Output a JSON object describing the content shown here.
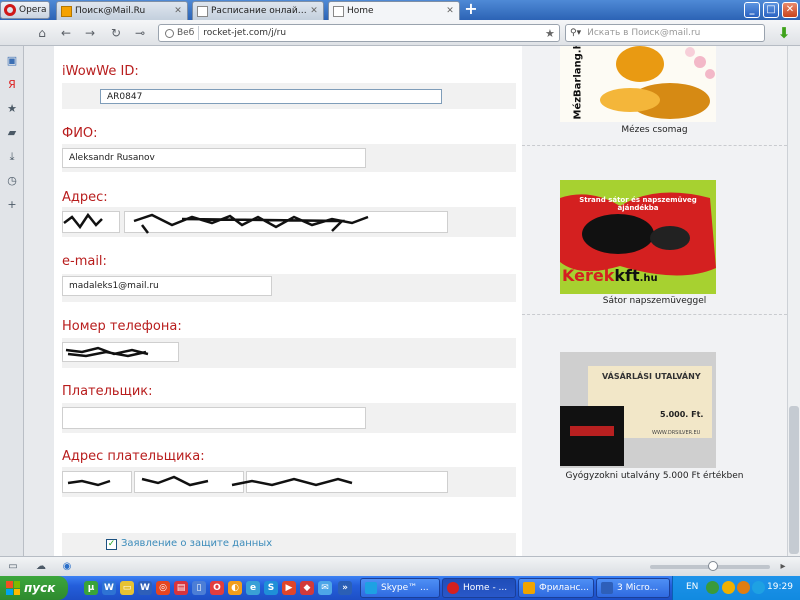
{
  "browser": {
    "menu_label": "Opera",
    "tabs": [
      {
        "label": "Поиск@Mail.Ru"
      },
      {
        "label": "Расписание онлайн пре..."
      },
      {
        "label": "Home"
      }
    ],
    "address": {
      "badge": "Веб",
      "url": "rocket-jet.com/j/ru"
    },
    "search_placeholder": "Искать в Поиск@mail.ru"
  },
  "form": {
    "fields": [
      {
        "label": "iWowWe ID:",
        "value": "AR0847"
      },
      {
        "label": "ФИО:",
        "value": "Aleksandr Rusanov"
      },
      {
        "label": "Адрес:",
        "value": ""
      },
      {
        "label": "e-mail:",
        "value": "madaleks1@mail.ru"
      },
      {
        "label": "Номер телефона:",
        "value": ""
      },
      {
        "label": "Плательщик:",
        "value": ""
      },
      {
        "label": "Адрес плательщика:",
        "value": ""
      }
    ],
    "consent": {
      "label": "Заявление о защите данных",
      "checked": true
    }
  },
  "ads": [
    {
      "caption": "Mézes csomag",
      "image_text": "MézBarlang.hu"
    },
    {
      "caption": "Sátor napszemüveggel",
      "image_text_top": "Strand sátor és napszemüveg ajándékba",
      "image_brand": "Kerék",
      "image_brand2": "kft",
      "image_brand3": ".hu"
    },
    {
      "caption": "Gyógyzokni utalvány 5.000 Ft értékben",
      "image_title": "VÁSÁRLÁSI UTALVÁNY",
      "image_amount": "5.000. Ft.",
      "image_url": "WWW.DRSILVER.EU"
    }
  ],
  "taskbar": {
    "start_label": "пуск",
    "tasks": [
      {
        "label": "Skype™ ..."
      },
      {
        "label": "Home - ..."
      },
      {
        "label": "Фриланс..."
      },
      {
        "label": "3 Micro..."
      }
    ],
    "lang": "EN",
    "clock": "19:29"
  },
  "colors": {
    "label_red": "#b81d1d",
    "link_blue": "#3b8bba",
    "check_green": "#21a121"
  }
}
